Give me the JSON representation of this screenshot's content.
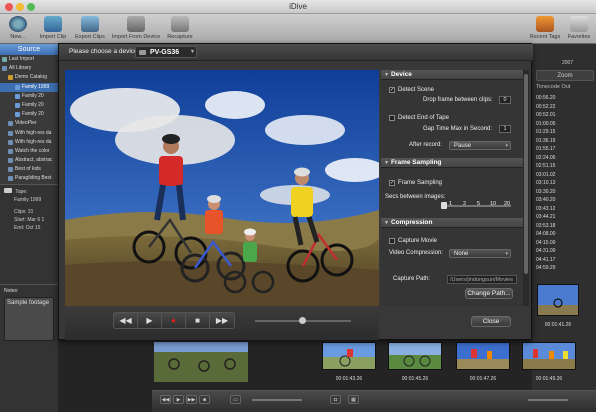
{
  "window": {
    "title": "iDive"
  },
  "toolbar": {
    "new": "New...",
    "import_clip": "Import Clip",
    "export_clips": "Export Clips",
    "import_from_device": "Import From Device",
    "recapture": "Recapture",
    "recent_tags": "Recent Tags",
    "favorites": "Favorites"
  },
  "sidebar": {
    "source_label": "Source",
    "items": [
      "Last Import",
      "All Library",
      "Demo Catalog",
      "Family 1999",
      "Family 20",
      "Family 20",
      "Family 20",
      "VideoPier",
      "With high-res da",
      "With high-res da",
      "Watch the color",
      "Abstract, abstrac",
      "Best of kids",
      "Paragliding Best",
      "Clips with footag",
      "Trash"
    ],
    "tape": {
      "label": "Tape:",
      "name": "Family 1999",
      "clips_label": "Clips:",
      "clips_value": "31",
      "start_label": "Start:",
      "start_value": "Mar 6 1",
      "end_label": "End:",
      "end_value": "Oct 15"
    },
    "notes_label": "Notes:",
    "notes_text": "Sample footage"
  },
  "right_panel": {
    "year": "2007",
    "zoom_label": "Zoom",
    "timecode_header": "Timecode Out",
    "timecodes": [
      "00:56.20",
      "00:52.22",
      "00:52.01",
      "01:00.05",
      "01:29.15",
      "01:36.19",
      "01:55.17",
      "02:24.06",
      "02:51.15",
      "03:01.02",
      "03:10.13",
      "03:30.20",
      "03:40.20",
      "03:43.12",
      "03:44.21",
      "03:53.18",
      "04:08.00",
      "04:15.09",
      "04:31.09",
      "04:41.17",
      "04:59.29"
    ],
    "thumb_top_label": "00:01:41.26"
  },
  "dialog": {
    "device_prompt": "Please choose a device:",
    "device_name": "PV-GS36",
    "sections": {
      "device": "Device",
      "frame_sampling": "Frame Sampling",
      "compression": "Compression"
    },
    "detect_scene": "Detect Scene",
    "drop_frame_label": "Drop frame between clips:",
    "drop_frame_value": "0",
    "detect_end_of_tape": "Detect End of Tape",
    "gap_time_label": "Gap Time Max in Second:",
    "gap_time_value": "1",
    "after_record_label": "After record:",
    "after_record_value": "Pause",
    "frame_sampling_check": "Frame Sampling",
    "secs_between_label": "Secs between images:",
    "secs_ticks": [
      "1",
      "2",
      "5",
      "10",
      "20"
    ],
    "capture_movie": "Capture Movie",
    "video_compression_label": "Video Compression:",
    "video_compression_value": "None",
    "capture_path_label": "Capture Path:",
    "capture_path_value": "/Users/jindongsun/Movies",
    "change_path_button": "Change Path...",
    "close_button": "Close"
  },
  "bottom_thumbnails": [
    "00:01:43.26",
    "00:01:45.26",
    "00:01:47.26",
    "00:01:49.26"
  ],
  "colors": {
    "selection": "#3d6fb0",
    "record": "#e02020",
    "dialog_bg": "#383838"
  }
}
